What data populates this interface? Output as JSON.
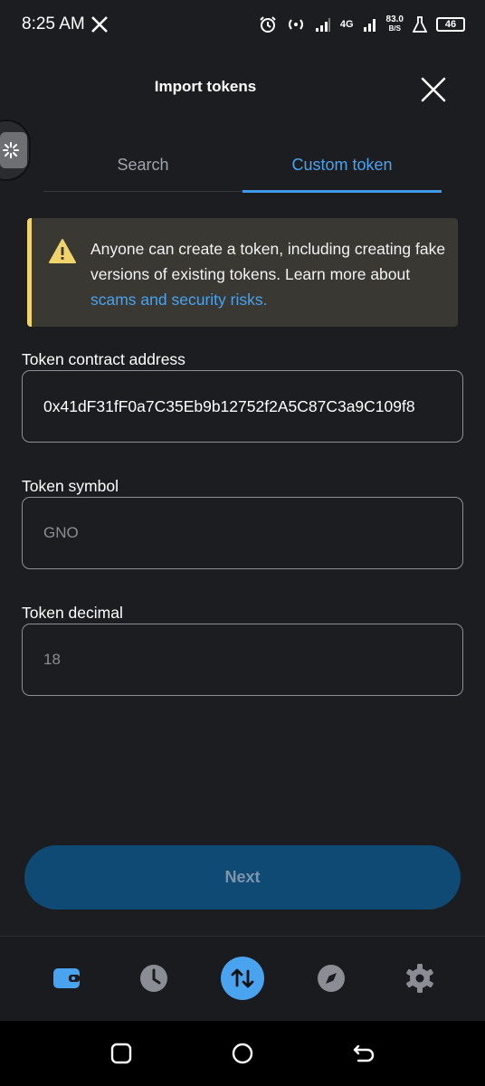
{
  "status_bar": {
    "time": "8:25 AM",
    "network": "4G",
    "speed_value": "83.0",
    "speed_unit": "B/S",
    "battery": "46"
  },
  "header": {
    "title": "Import tokens"
  },
  "tabs": [
    {
      "label": "Search",
      "active": false
    },
    {
      "label": "Custom token",
      "active": true
    }
  ],
  "alert": {
    "text": "Anyone can create a token, including creating fake versions of existing tokens. Learn more about ",
    "link": "scams and security risks."
  },
  "form": {
    "address_label": "Token contract address",
    "address_value": "0x41dF31fF0a7C35Eb9b12752f2A5C87C3a9C109f8",
    "symbol_label": "Token symbol",
    "symbol_placeholder": "GNO",
    "decimal_label": "Token decimal",
    "decimal_placeholder": "18"
  },
  "next_button": "Next",
  "bottom_nav": {
    "items": [
      "wallet-icon",
      "clock-icon",
      "swap-icon",
      "compass-icon",
      "gear-icon"
    ],
    "active": "wallet-icon"
  },
  "colors": {
    "accent": "#4aa3ee",
    "warning": "#f1d36c",
    "background": "#1c1d20",
    "button_disabled": "#0e4a74"
  }
}
